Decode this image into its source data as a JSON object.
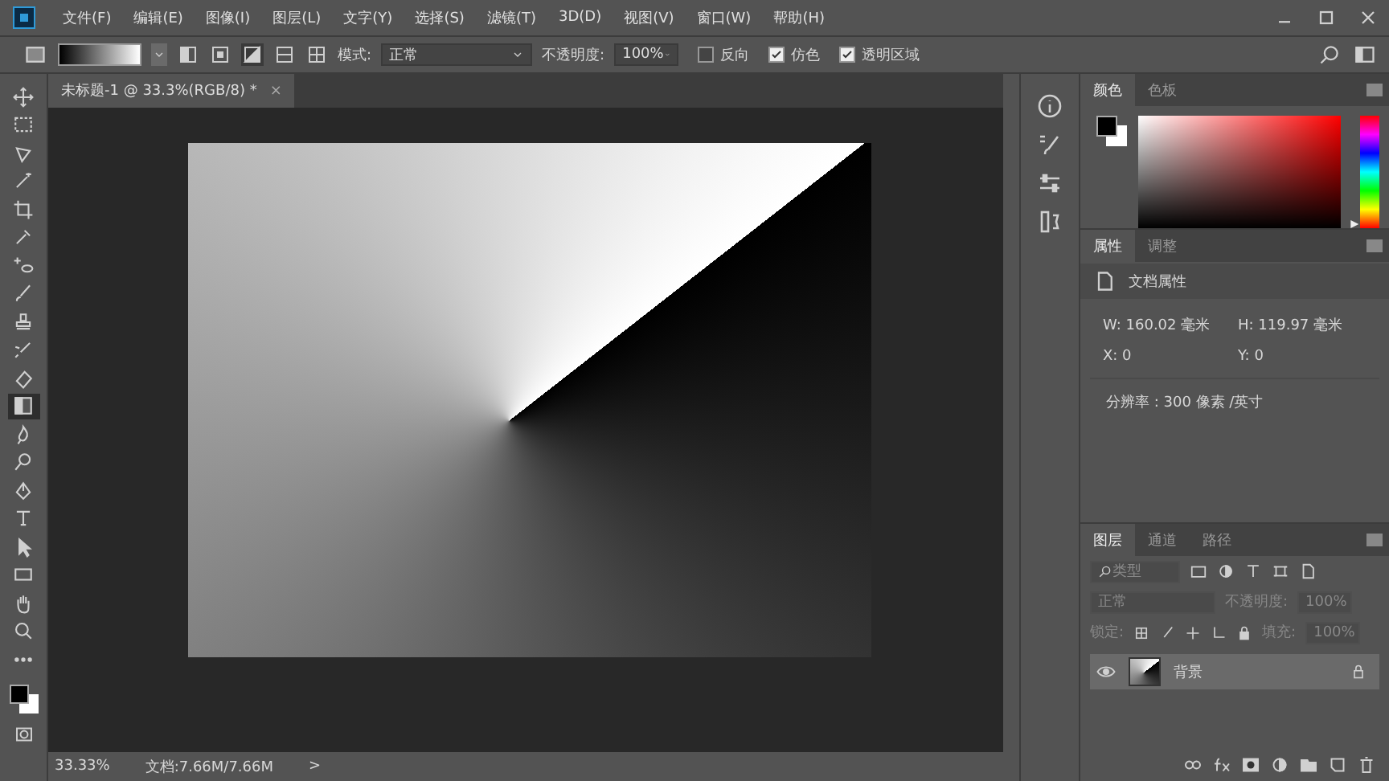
{
  "menu": [
    "文件(F)",
    "编辑(E)",
    "图像(I)",
    "图层(L)",
    "文字(Y)",
    "选择(S)",
    "滤镜(T)",
    "3D(D)",
    "视图(V)",
    "窗口(W)",
    "帮助(H)"
  ],
  "options": {
    "gradient_types": [
      {
        "kind": "linear",
        "selected": false
      },
      {
        "kind": "radial",
        "selected": false
      },
      {
        "kind": "angle",
        "selected": true
      },
      {
        "kind": "reflected",
        "selected": false
      },
      {
        "kind": "diamond",
        "selected": false
      }
    ],
    "mode_label": "模式:",
    "mode": "正常",
    "opacity_label": "不透明度:",
    "opacity": "100%",
    "checks": [
      {
        "label": "反向",
        "checked": false
      },
      {
        "label": "仿色",
        "checked": true
      },
      {
        "label": "透明区域",
        "checked": true
      }
    ]
  },
  "document_tab": {
    "title": "未标题-1 @ 33.3%(RGB/8) *",
    "close": "×"
  },
  "tools": [
    {
      "kind": "move",
      "selected": false
    },
    {
      "kind": "marquee",
      "selected": false
    },
    {
      "kind": "lasso",
      "selected": false
    },
    {
      "kind": "wand",
      "selected": false
    },
    {
      "kind": "crop",
      "selected": false
    },
    {
      "kind": "eyedropper",
      "selected": false
    },
    {
      "kind": "heal",
      "selected": false
    },
    {
      "kind": "brush",
      "selected": false
    },
    {
      "kind": "stamp",
      "selected": false
    },
    {
      "kind": "history-brush",
      "selected": false
    },
    {
      "kind": "eraser",
      "selected": false
    },
    {
      "kind": "gradient",
      "selected": true
    },
    {
      "kind": "blur",
      "selected": false
    },
    {
      "kind": "dodge",
      "selected": false
    },
    {
      "kind": "pen",
      "selected": false
    },
    {
      "kind": "type",
      "selected": false
    },
    {
      "kind": "select",
      "selected": false
    },
    {
      "kind": "shape",
      "selected": false
    },
    {
      "kind": "hand",
      "selected": false
    },
    {
      "kind": "zoom",
      "selected": false
    },
    {
      "kind": "more",
      "selected": false
    }
  ],
  "color_panel": {
    "tabs": [
      {
        "label": "颜色",
        "selected": true
      },
      {
        "label": "色板",
        "selected": false
      }
    ],
    "hue": {
      "level": 0
    }
  },
  "properties_panel": {
    "tabs": [
      {
        "label": "属性",
        "selected": true
      },
      {
        "label": "调整",
        "selected": false
      }
    ],
    "heading": "文档属性",
    "fields": [
      {
        "label": "W:",
        "value": "160.02 毫米"
      },
      {
        "label": "H:",
        "value": "119.97 毫米"
      },
      {
        "label": "X:",
        "value": "0"
      },
      {
        "label": "Y:",
        "value": "0"
      }
    ],
    "resolution": "分辨率 : 300 像素 /英寸"
  },
  "layers_panel": {
    "tabs": [
      {
        "label": "图层",
        "selected": true
      },
      {
        "label": "通道",
        "selected": false
      },
      {
        "label": "路径",
        "selected": false
      }
    ],
    "filter": "类型",
    "blend": "正常",
    "opacity_label": "不透明度:",
    "opacity": "100%",
    "lock_label": "锁定:",
    "fill_label": "填充:",
    "fill": "100%",
    "layers": [
      {
        "name": "背景",
        "visible": true,
        "locked": true
      }
    ]
  },
  "status_bar": {
    "zoom": "33.33%",
    "doc": "文档:7.66M/7.66M",
    "arrow": ">"
  }
}
